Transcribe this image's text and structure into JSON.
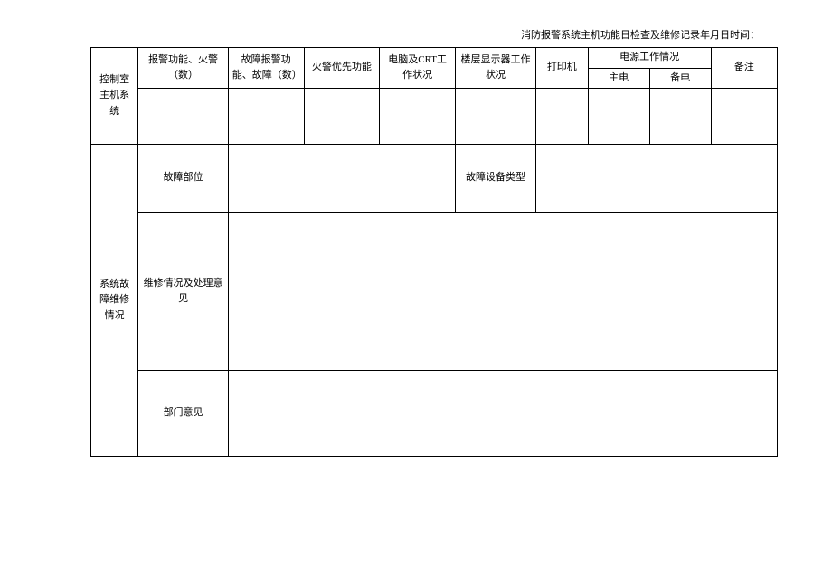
{
  "title": "消防报警系统主机功能日检查及维修记录年月日时间：",
  "section1": {
    "group_label": "控制室主机系统",
    "headers": {
      "alarm_fire": "报警功能、火警（数）",
      "fault_alarm": "故障报警功能、故障（数）",
      "fire_priority": "火警优先功能",
      "pc_crt": "电脑及CRT工作状况",
      "floor_display": "楼层显示器工作状况",
      "printer": "打印机",
      "power_group": "电源工作情况",
      "power_main": "主电",
      "power_backup": "备电",
      "remark": "备注"
    }
  },
  "section2": {
    "group_label": "系统故障维修情况",
    "fault_location": "故障部位",
    "fault_device_type": "故障设备类型",
    "maint_opinion": "维修情况及处理意见",
    "dept_opinion": "部门意见"
  }
}
